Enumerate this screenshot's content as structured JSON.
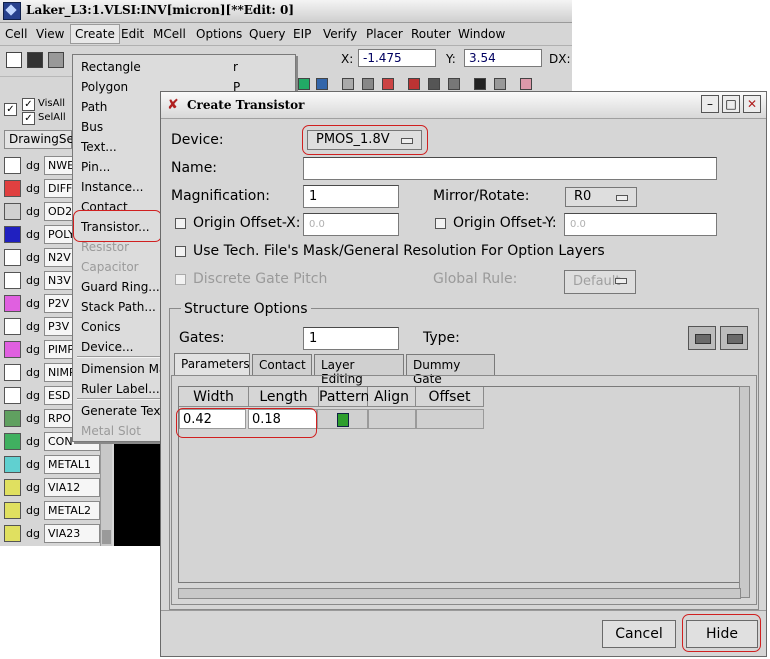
{
  "main_window": {
    "title": "Laker_L3:1.VLSI:INV[micron][**Edit: 0]",
    "menu": [
      "Cell",
      "View",
      "Create",
      "Edit",
      "MCell",
      "Options",
      "Query",
      "EIP",
      "Verify",
      "Placer",
      "Router",
      "Window"
    ],
    "coords": {
      "x_label": "X:",
      "x_value": "-1.475",
      "y_label": "Y:",
      "y_value": "3.54",
      "dx_label": "DX:"
    },
    "vis_all": "VisAll",
    "sel_all": "SelAll",
    "drawing_set": "DrawingSe",
    "layers": [
      {
        "tag": "dg",
        "name": "NWE",
        "color": "#ffffff"
      },
      {
        "tag": "dg",
        "name": "DIFF",
        "color": "#e04040"
      },
      {
        "tag": "dg",
        "name": "OD2",
        "color": "#d0d0d0"
      },
      {
        "tag": "dg",
        "name": "POLY",
        "color": "#2020c0"
      },
      {
        "tag": "dg",
        "name": "N2V",
        "color": "#ffffff"
      },
      {
        "tag": "dg",
        "name": "N3V",
        "color": "#ffffff"
      },
      {
        "tag": "dg",
        "name": "P2V",
        "color": "#e060e0"
      },
      {
        "tag": "dg",
        "name": "P3V",
        "color": "#ffffff"
      },
      {
        "tag": "dg",
        "name": "PIMP",
        "color": "#e060e0"
      },
      {
        "tag": "dg",
        "name": "NIMP",
        "color": "#ffffff"
      },
      {
        "tag": "dg",
        "name": "ESD",
        "color": "#ffffff"
      },
      {
        "tag": "dg",
        "name": "RPO",
        "color": "#60a060"
      },
      {
        "tag": "dg",
        "name": "CON",
        "color": "#40b060"
      },
      {
        "tag": "dg",
        "name": "METAL1",
        "color": "#60d0d0"
      },
      {
        "tag": "dg",
        "name": "VIA12",
        "color": "#e0e060"
      },
      {
        "tag": "dg",
        "name": "METAL2",
        "color": "#e0e060"
      },
      {
        "tag": "dg",
        "name": "VIA23",
        "color": "#e0e060"
      }
    ]
  },
  "create_menu": {
    "items": [
      {
        "label": "Rectangle",
        "accel": "r",
        "disabled": false
      },
      {
        "label": "Polygon",
        "accel": "P",
        "disabled": false
      },
      {
        "label": "Path",
        "accel": "",
        "disabled": false
      },
      {
        "label": "Bus",
        "accel": "",
        "disabled": false
      },
      {
        "label": "Text...",
        "accel": "",
        "disabled": false
      },
      {
        "label": "Pin...",
        "accel": "",
        "disabled": false
      },
      {
        "label": "Instance...",
        "accel": "",
        "disabled": false
      },
      {
        "label": "Contact",
        "accel": "",
        "disabled": false
      },
      {
        "label": "Transistor...",
        "accel": "",
        "disabled": false
      },
      {
        "label": "Resistor",
        "accel": "",
        "disabled": true
      },
      {
        "label": "Capacitor",
        "accel": "",
        "disabled": true
      },
      {
        "label": "Guard Ring...",
        "accel": "",
        "disabled": false
      },
      {
        "label": "Stack Path...",
        "accel": "",
        "disabled": false
      },
      {
        "label": "Conics",
        "accel": "",
        "disabled": false
      },
      {
        "label": "Device...",
        "accel": "",
        "disabled": false
      },
      {
        "label": "Dimension Ma",
        "accel": "",
        "disabled": false
      },
      {
        "label": "Ruler Label...",
        "accel": "",
        "disabled": false
      },
      {
        "label": "Generate Text...",
        "accel": "",
        "disabled": false
      },
      {
        "label": "Metal Slot",
        "accel": "",
        "disabled": true
      }
    ]
  },
  "dialog": {
    "title": "Create Transistor",
    "device_label": "Device:",
    "device_value": "PMOS_1.8V",
    "name_label": "Name:",
    "name_value": "",
    "magnification_label": "Magnification:",
    "magnification_value": "1",
    "mirror_label": "Mirror/Rotate:",
    "mirror_value": "R0",
    "origin_x_label": "Origin Offset-X:",
    "origin_x_value": "0.0",
    "origin_y_label": "Origin Offset-Y:",
    "origin_y_value": "0.0",
    "use_tech_label": "Use Tech. File's Mask/General Resolution For Option Layers",
    "discrete_label": "Discrete Gate Pitch",
    "global_rule_label": "Global Rule:",
    "global_rule_value": "Default",
    "structure_label": "Structure Options",
    "gates_label": "Gates:",
    "gates_value": "1",
    "type_label": "Type:",
    "tabs": [
      "Parameters",
      "Contact",
      "Layer Editing",
      "Dummy Gate"
    ],
    "columns": [
      "Width",
      "Length",
      "Pattern",
      "Align",
      "Offset"
    ],
    "row": {
      "width": "0.42",
      "length": "0.18"
    },
    "cancel_label": "Cancel",
    "hide_label": "Hide"
  }
}
